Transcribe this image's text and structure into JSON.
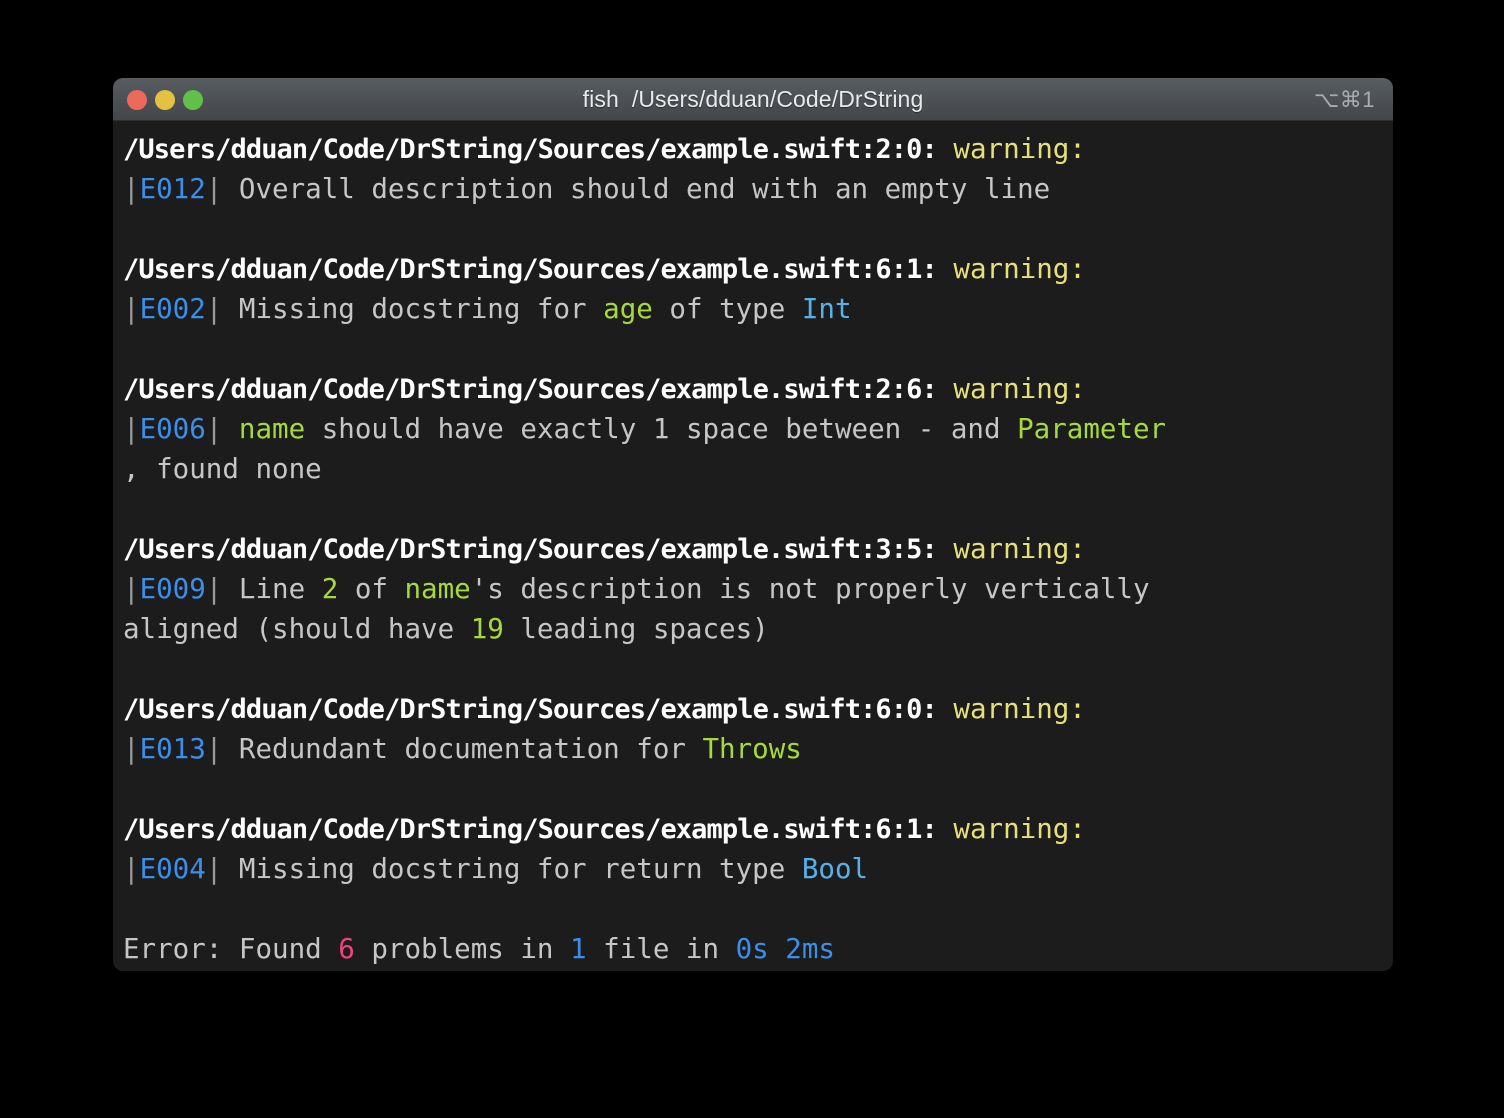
{
  "window": {
    "title": "fish  /Users/dduan/Code/DrString",
    "shortcut": "⌥⌘1",
    "traffic_lights": [
      "close",
      "minimize",
      "zoom"
    ],
    "colors": {
      "background": "#1c1c1c",
      "titlebar": "#4c5054",
      "text": "#c6c6c6",
      "path": "#ffffff",
      "warning": "#e6e177",
      "code": "#3b8eea",
      "green": "#a6d93c",
      "cyan": "#58b0e8",
      "pink": "#f0427f"
    }
  },
  "terminal": {
    "diagnostics": [
      {
        "path": "/Users/dduan/Code/DrString/Sources/example.swift:2:0:",
        "severity": "warning:",
        "code": "E012",
        "message_lines": [
          [
            {
              "text": " Overall description should end with an empty line",
              "style": "gry"
            }
          ]
        ]
      },
      {
        "path": "/Users/dduan/Code/DrString/Sources/example.swift:6:1:",
        "severity": "warning:",
        "code": "E002",
        "message_lines": [
          [
            {
              "text": " Missing docstring for ",
              "style": "gry"
            },
            {
              "text": "age",
              "style": "grn"
            },
            {
              "text": " of type ",
              "style": "gry"
            },
            {
              "text": "Int",
              "style": "cyn"
            }
          ]
        ]
      },
      {
        "path": "/Users/dduan/Code/DrString/Sources/example.swift:2:6:",
        "severity": "warning:",
        "code": "E006",
        "message_lines": [
          [
            {
              "text": " ",
              "style": "gry"
            },
            {
              "text": "name",
              "style": "grn"
            },
            {
              "text": " should have exactly 1 space between - and ",
              "style": "gry"
            },
            {
              "text": "Parameter",
              "style": "grn"
            }
          ],
          [
            {
              "text": ", found none",
              "style": "gry"
            }
          ]
        ]
      },
      {
        "path": "/Users/dduan/Code/DrString/Sources/example.swift:3:5:",
        "severity": "warning:",
        "code": "E009",
        "message_lines": [
          [
            {
              "text": " Line ",
              "style": "gry"
            },
            {
              "text": "2",
              "style": "grn"
            },
            {
              "text": " of ",
              "style": "gry"
            },
            {
              "text": "name",
              "style": "grn"
            },
            {
              "text": "'s description is not properly vertically",
              "style": "gry"
            }
          ],
          [
            {
              "text": "aligned (should have ",
              "style": "gry"
            },
            {
              "text": "19",
              "style": "grn"
            },
            {
              "text": " leading spaces)",
              "style": "gry"
            }
          ]
        ]
      },
      {
        "path": "/Users/dduan/Code/DrString/Sources/example.swift:6:0:",
        "severity": "warning:",
        "code": "E013",
        "message_lines": [
          [
            {
              "text": " Redundant documentation for ",
              "style": "gry"
            },
            {
              "text": "Throws",
              "style": "grn"
            }
          ]
        ]
      },
      {
        "path": "/Users/dduan/Code/DrString/Sources/example.swift:6:1:",
        "severity": "warning:",
        "code": "E004",
        "message_lines": [
          [
            {
              "text": " Missing docstring for return type ",
              "style": "gry"
            },
            {
              "text": "Bool",
              "style": "cyn"
            }
          ]
        ]
      }
    ],
    "summary": [
      {
        "text": "Error: Found ",
        "style": "gry"
      },
      {
        "text": "6",
        "style": "pnk"
      },
      {
        "text": " problems in ",
        "style": "gry"
      },
      {
        "text": "1",
        "style": "blu"
      },
      {
        "text": " file in ",
        "style": "gry"
      },
      {
        "text": "0s",
        "style": "blu"
      },
      {
        "text": " ",
        "style": "gry"
      },
      {
        "text": "2ms",
        "style": "blu"
      }
    ]
  }
}
